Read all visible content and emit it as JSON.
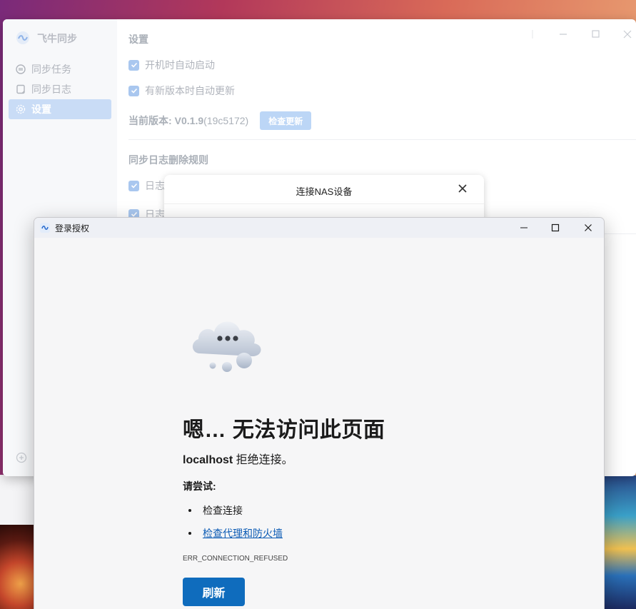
{
  "app": {
    "title": "飞牛同步",
    "sidebar": {
      "items": [
        {
          "label": "同步任务",
          "icon": "sync-icon"
        },
        {
          "label": "同步日志",
          "icon": "log-icon"
        },
        {
          "label": "设置",
          "icon": "gear-icon",
          "active": true
        }
      ]
    },
    "main": {
      "title": "设置",
      "settings": [
        {
          "label": "开机时自动启动",
          "checked": true
        },
        {
          "label": "有新版本时自动更新",
          "checked": true
        }
      ],
      "version_label": "当前版本:",
      "version_number": "V0.1.9",
      "version_build": "(19c5172)",
      "check_update_button": "检查更新",
      "log_rules_title": "同步日志删除规则",
      "log_rule_items": [
        {
          "label": "日志",
          "checked": true
        },
        {
          "label": "日志",
          "checked": true
        }
      ]
    }
  },
  "nas_dialog": {
    "title": "连接NAS设备"
  },
  "auth_window": {
    "title": "登录授权",
    "error": {
      "heading": "嗯… 无法访问此页面",
      "host": "localhost",
      "message": " 拒绝连接。",
      "try_label": "请尝试:",
      "tips": [
        {
          "label": "检查连接",
          "link": false
        },
        {
          "label": "检查代理和防火墙",
          "link": true
        }
      ],
      "code": "ERR_CONNECTION_REFUSED",
      "refresh_button": "刷新"
    }
  },
  "colors": {
    "accent": "#0f6cbd",
    "sidebar_active": "#c9dcf6",
    "link": "#0a5ab4"
  }
}
